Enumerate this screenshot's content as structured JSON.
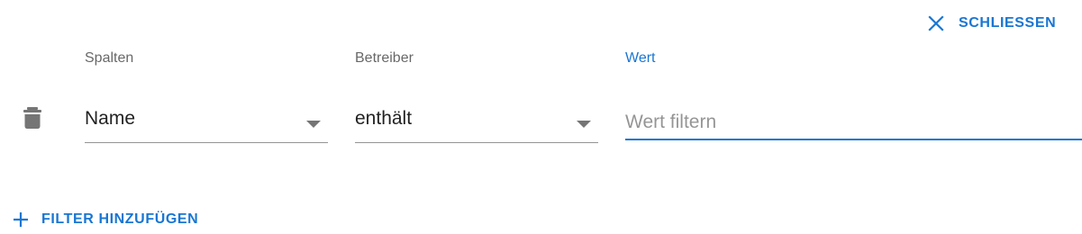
{
  "close_button": {
    "label": "SCHLIESSEN",
    "icon": "close-icon"
  },
  "filter_row": {
    "delete_icon": "trash-icon",
    "column": {
      "label": "Spalten",
      "value": "Name"
    },
    "operator": {
      "label": "Betreiber",
      "value": "enthält"
    },
    "value": {
      "label": "Wert",
      "placeholder": "Wert filtern",
      "current": ""
    }
  },
  "add_filter_button": {
    "label": "FILTER HINZUFÜGEN",
    "icon": "plus-icon"
  },
  "colors": {
    "accent": "#1976d2",
    "label": "#666666",
    "icon": "#757575"
  }
}
